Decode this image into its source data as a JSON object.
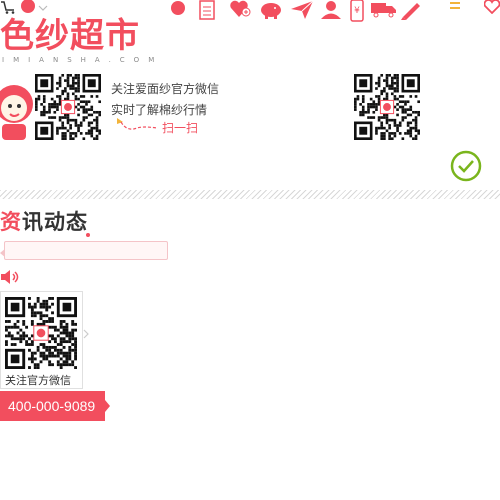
{
  "brand": {
    "logo_text": "色纱超市",
    "logo_sub": "IMIANSHA.COM",
    "accent": "#f24e5e"
  },
  "top_icons": [
    "cart-icon",
    "record-icon",
    "document-icon",
    "heart-plus-icon",
    "piggy-bank-icon",
    "paper-plane-icon",
    "user-icon",
    "phone-yuan-icon",
    "truck-icon",
    "pencil-icon",
    "menu-icon",
    "heart-icon"
  ],
  "follow": {
    "line1": "关注爱面纱官方微信",
    "line2": "实时了解棉纱行情",
    "scan": "扫一扫"
  },
  "news": {
    "title_first": "资",
    "title_rest": "讯动态"
  },
  "search": {
    "placeholder": "",
    "value": ""
  },
  "side_qr": {
    "label": "关注官方微信"
  },
  "hotline": "400-000-9089"
}
